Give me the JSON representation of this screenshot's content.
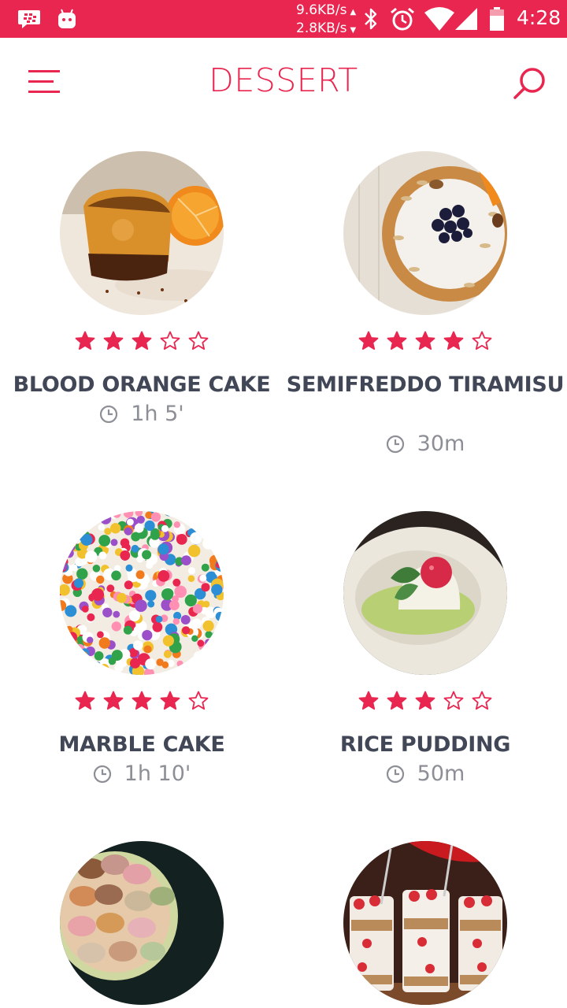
{
  "status_bar": {
    "net_down": "9.6KB/s",
    "net_up": "2.8KB/s",
    "time": "4:28",
    "icons": [
      "bbm-icon",
      "android-icon",
      "bluetooth-icon",
      "alarm-icon",
      "wifi-icon",
      "signal-icon",
      "battery-icon"
    ]
  },
  "app_bar": {
    "title": "DESSERT",
    "menu_icon": "hamburger-menu-icon",
    "search_icon": "search-icon"
  },
  "colors": {
    "accent": "#e8264f",
    "title_text": "#414756",
    "meta_text": "#8c8f96"
  },
  "recipes": [
    {
      "name": "BLOOD ORANGE CAKE",
      "rating": 3,
      "max_rating": 5,
      "time": "1h 5'"
    },
    {
      "name": "SEMIFREDDO TIRAMISU",
      "rating": 4,
      "max_rating": 5,
      "time": "30m"
    },
    {
      "name": "MARBLE CAKE",
      "rating": 4,
      "max_rating": 5,
      "time": "1h 10'"
    },
    {
      "name": "RICE PUDDING",
      "rating": 3,
      "max_rating": 5,
      "time": "50m"
    },
    {
      "name": "",
      "rating": null,
      "max_rating": 5,
      "time": ""
    },
    {
      "name": "",
      "rating": null,
      "max_rating": 5,
      "time": ""
    }
  ]
}
